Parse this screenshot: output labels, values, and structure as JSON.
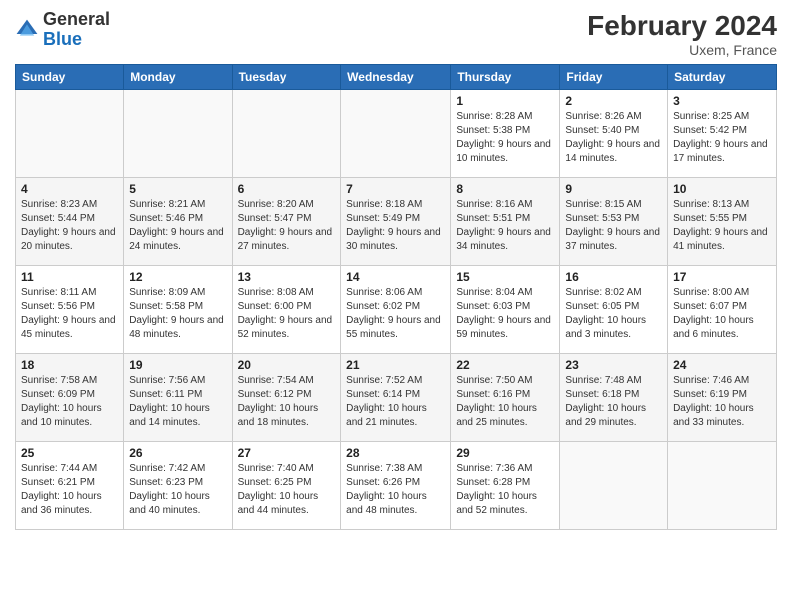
{
  "header": {
    "logo_general": "General",
    "logo_blue": "Blue",
    "month_title": "February 2024",
    "location": "Uxem, France"
  },
  "days_of_week": [
    "Sunday",
    "Monday",
    "Tuesday",
    "Wednesday",
    "Thursday",
    "Friday",
    "Saturday"
  ],
  "weeks": [
    [
      {
        "num": "",
        "info": ""
      },
      {
        "num": "",
        "info": ""
      },
      {
        "num": "",
        "info": ""
      },
      {
        "num": "",
        "info": ""
      },
      {
        "num": "1",
        "info": "Sunrise: 8:28 AM\nSunset: 5:38 PM\nDaylight: 9 hours and 10 minutes."
      },
      {
        "num": "2",
        "info": "Sunrise: 8:26 AM\nSunset: 5:40 PM\nDaylight: 9 hours and 14 minutes."
      },
      {
        "num": "3",
        "info": "Sunrise: 8:25 AM\nSunset: 5:42 PM\nDaylight: 9 hours and 17 minutes."
      }
    ],
    [
      {
        "num": "4",
        "info": "Sunrise: 8:23 AM\nSunset: 5:44 PM\nDaylight: 9 hours and 20 minutes."
      },
      {
        "num": "5",
        "info": "Sunrise: 8:21 AM\nSunset: 5:46 PM\nDaylight: 9 hours and 24 minutes."
      },
      {
        "num": "6",
        "info": "Sunrise: 8:20 AM\nSunset: 5:47 PM\nDaylight: 9 hours and 27 minutes."
      },
      {
        "num": "7",
        "info": "Sunrise: 8:18 AM\nSunset: 5:49 PM\nDaylight: 9 hours and 30 minutes."
      },
      {
        "num": "8",
        "info": "Sunrise: 8:16 AM\nSunset: 5:51 PM\nDaylight: 9 hours and 34 minutes."
      },
      {
        "num": "9",
        "info": "Sunrise: 8:15 AM\nSunset: 5:53 PM\nDaylight: 9 hours and 37 minutes."
      },
      {
        "num": "10",
        "info": "Sunrise: 8:13 AM\nSunset: 5:55 PM\nDaylight: 9 hours and 41 minutes."
      }
    ],
    [
      {
        "num": "11",
        "info": "Sunrise: 8:11 AM\nSunset: 5:56 PM\nDaylight: 9 hours and 45 minutes."
      },
      {
        "num": "12",
        "info": "Sunrise: 8:09 AM\nSunset: 5:58 PM\nDaylight: 9 hours and 48 minutes."
      },
      {
        "num": "13",
        "info": "Sunrise: 8:08 AM\nSunset: 6:00 PM\nDaylight: 9 hours and 52 minutes."
      },
      {
        "num": "14",
        "info": "Sunrise: 8:06 AM\nSunset: 6:02 PM\nDaylight: 9 hours and 55 minutes."
      },
      {
        "num": "15",
        "info": "Sunrise: 8:04 AM\nSunset: 6:03 PM\nDaylight: 9 hours and 59 minutes."
      },
      {
        "num": "16",
        "info": "Sunrise: 8:02 AM\nSunset: 6:05 PM\nDaylight: 10 hours and 3 minutes."
      },
      {
        "num": "17",
        "info": "Sunrise: 8:00 AM\nSunset: 6:07 PM\nDaylight: 10 hours and 6 minutes."
      }
    ],
    [
      {
        "num": "18",
        "info": "Sunrise: 7:58 AM\nSunset: 6:09 PM\nDaylight: 10 hours and 10 minutes."
      },
      {
        "num": "19",
        "info": "Sunrise: 7:56 AM\nSunset: 6:11 PM\nDaylight: 10 hours and 14 minutes."
      },
      {
        "num": "20",
        "info": "Sunrise: 7:54 AM\nSunset: 6:12 PM\nDaylight: 10 hours and 18 minutes."
      },
      {
        "num": "21",
        "info": "Sunrise: 7:52 AM\nSunset: 6:14 PM\nDaylight: 10 hours and 21 minutes."
      },
      {
        "num": "22",
        "info": "Sunrise: 7:50 AM\nSunset: 6:16 PM\nDaylight: 10 hours and 25 minutes."
      },
      {
        "num": "23",
        "info": "Sunrise: 7:48 AM\nSunset: 6:18 PM\nDaylight: 10 hours and 29 minutes."
      },
      {
        "num": "24",
        "info": "Sunrise: 7:46 AM\nSunset: 6:19 PM\nDaylight: 10 hours and 33 minutes."
      }
    ],
    [
      {
        "num": "25",
        "info": "Sunrise: 7:44 AM\nSunset: 6:21 PM\nDaylight: 10 hours and 36 minutes."
      },
      {
        "num": "26",
        "info": "Sunrise: 7:42 AM\nSunset: 6:23 PM\nDaylight: 10 hours and 40 minutes."
      },
      {
        "num": "27",
        "info": "Sunrise: 7:40 AM\nSunset: 6:25 PM\nDaylight: 10 hours and 44 minutes."
      },
      {
        "num": "28",
        "info": "Sunrise: 7:38 AM\nSunset: 6:26 PM\nDaylight: 10 hours and 48 minutes."
      },
      {
        "num": "29",
        "info": "Sunrise: 7:36 AM\nSunset: 6:28 PM\nDaylight: 10 hours and 52 minutes."
      },
      {
        "num": "",
        "info": ""
      },
      {
        "num": "",
        "info": ""
      }
    ]
  ]
}
